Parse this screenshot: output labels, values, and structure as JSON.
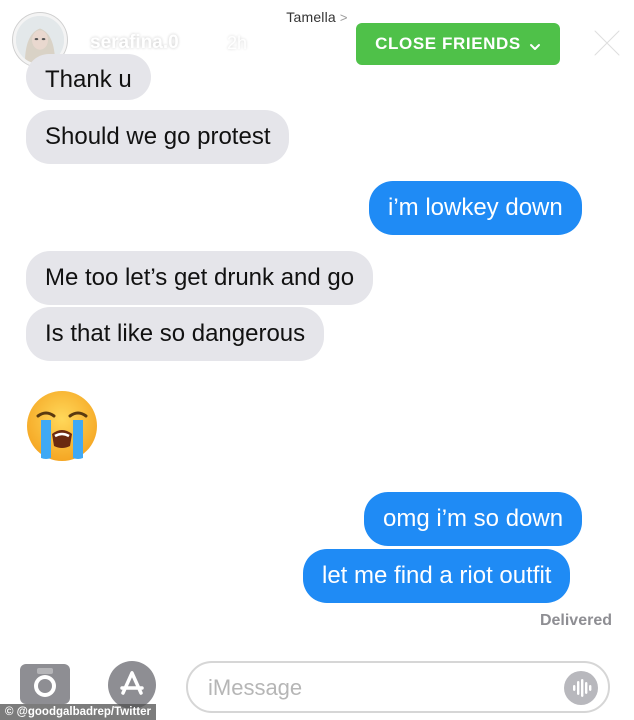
{
  "header": {
    "contact_name": "Tamella",
    "story_user": "serafina.0",
    "story_time": "2h",
    "close_friends_label": "CLOSE FRIENDS"
  },
  "messages": [
    {
      "from": "them",
      "text": "Thank u"
    },
    {
      "from": "them",
      "text": "Should we go protest"
    },
    {
      "from": "me",
      "text": "i’m lowkey down"
    },
    {
      "from": "them",
      "text": "Me too let’s get drunk and go"
    },
    {
      "from": "them",
      "text": "Is that like so dangerous"
    },
    {
      "from": "them",
      "emoji": "loudly-crying-face-icon"
    },
    {
      "from": "me",
      "text": "omg i’m so down"
    },
    {
      "from": "me",
      "text": "let me find a riot outfit"
    }
  ],
  "status": {
    "delivered": "Delivered"
  },
  "composer": {
    "placeholder": "iMessage"
  },
  "credit": "© @goodgalbadrep/Twitter",
  "colors": {
    "incoming_bubble": "#e5e5ea",
    "outgoing_bubble": "#1f8bf5",
    "close_friends_green": "#4fc149"
  }
}
